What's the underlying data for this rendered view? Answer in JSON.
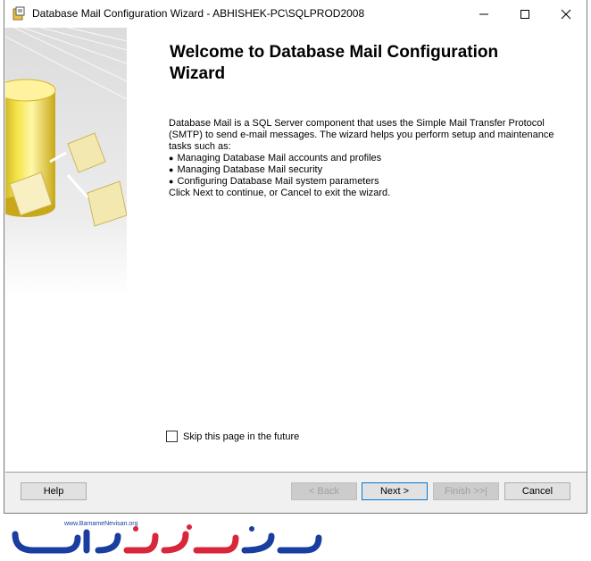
{
  "window": {
    "title": "Database Mail Configuration Wizard - ABHISHEK-PC\\SQLPROD2008",
    "icon": "wizard-app-icon",
    "controls": {
      "minimize": "—",
      "maximize": "☐",
      "close": "✕"
    }
  },
  "page": {
    "heading": "Welcome to Database Mail Configuration Wizard",
    "intro": "Database Mail is a SQL Server component that uses the Simple Mail Transfer Protocol (SMTP) to send e-mail messages. The wizard helps you perform setup and maintenance tasks such as:",
    "tasks": [
      "Managing Database Mail accounts and profiles",
      "Managing Database Mail security",
      "Configuring Database Mail system parameters"
    ],
    "hint": "Click Next to continue, or Cancel to exit the wizard.",
    "skip_label": "Skip this page in the future",
    "skip_checked": false
  },
  "buttons": {
    "help": "Help",
    "back": "< Back",
    "next": "Next >",
    "finish": "Finish >>|",
    "cancel": "Cancel"
  },
  "watermark": {
    "url": "www.BarnameNevisan.org"
  },
  "colors": {
    "accent": "#0078d7",
    "watermark_blue": "#1a3ea0",
    "watermark_red": "#d8263a"
  }
}
